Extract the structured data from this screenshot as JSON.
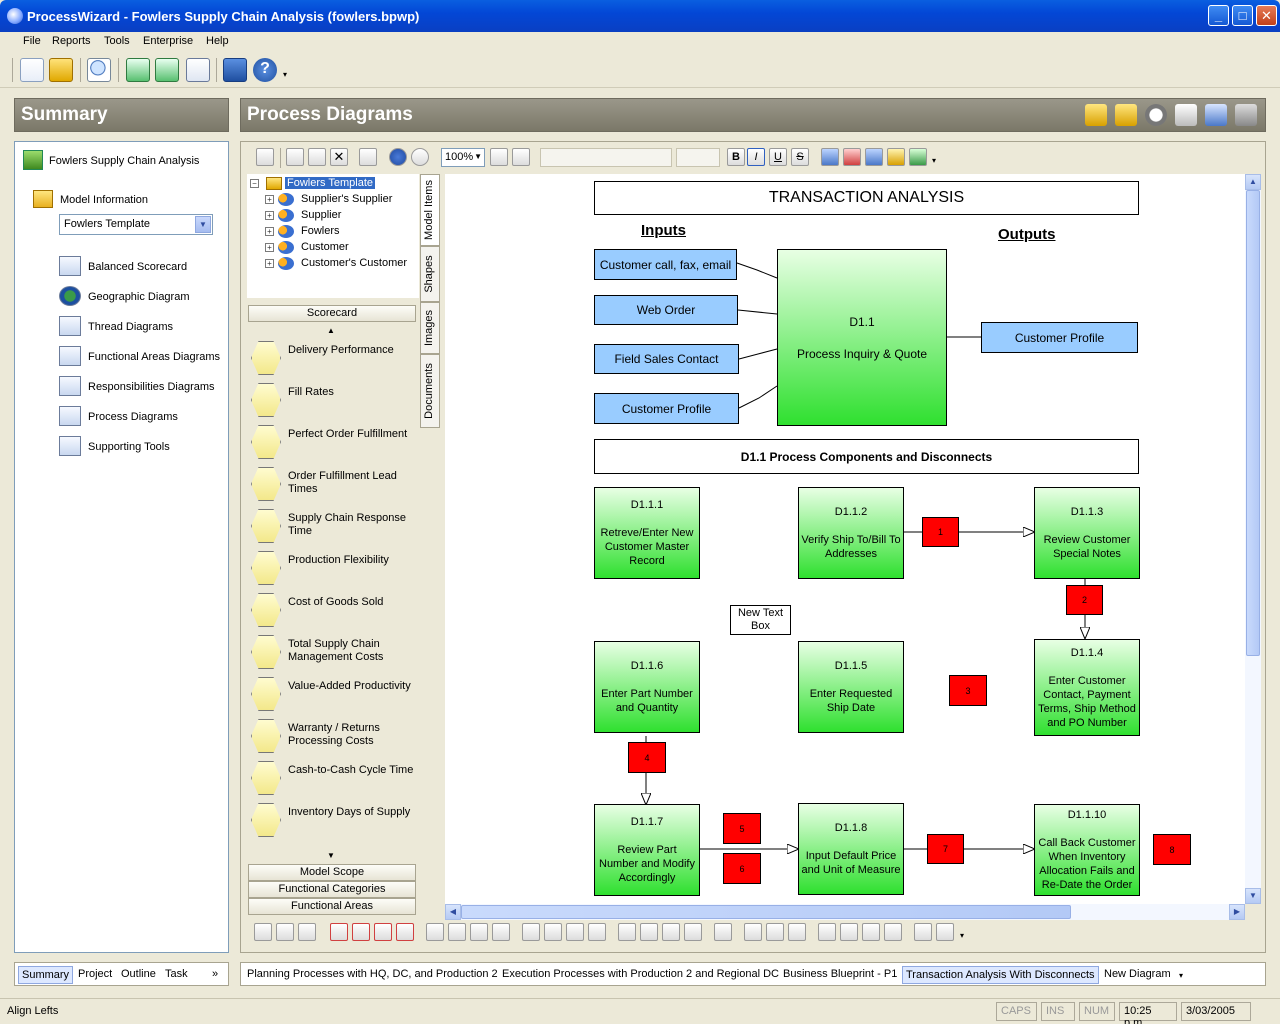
{
  "window": {
    "title": "ProcessWizard - Fowlers Supply Chain Analysis  (fowlers.bpwp)"
  },
  "menu": [
    "File",
    "Reports",
    "Tools",
    "Enterprise",
    "Help"
  ],
  "summary": {
    "heading": "Summary",
    "project": "Fowlers Supply Chain Analysis",
    "model_info_label": "Model Information",
    "model_select": "Fowlers Template",
    "items": [
      "Balanced Scorecard",
      "Geographic Diagram",
      "Thread Diagrams",
      "Functional Areas Diagrams",
      "Responsibilities Diagrams",
      "Process Diagrams",
      "Supporting Tools"
    ]
  },
  "process": {
    "heading": "Process Diagrams",
    "zoom": "100%",
    "tree": {
      "root": "Fowlers Template",
      "children": [
        "Supplier's Supplier",
        "Supplier",
        "Fowlers",
        "Customer",
        "Customer's Customer"
      ]
    },
    "side_tabs": [
      "Model Items",
      "Shapes",
      "Images",
      "Documents"
    ],
    "shapes": {
      "category": "Scorecard",
      "kpis": [
        "Delivery Performance",
        "Fill Rates",
        "Perfect Order Fulfillment",
        "Order Fulfillment Lead Times",
        "Supply Chain Response Time",
        "Production Flexibility",
        "Cost of Goods Sold",
        "Total Supply Chain Management Costs",
        "Value-Added Productivity",
        "Warranty / Returns Processing Costs",
        "Cash-to-Cash Cycle Time",
        "Inventory Days of Supply"
      ],
      "footer_bars": [
        "Model Scope",
        "Functional Categories",
        "Functional Areas"
      ]
    }
  },
  "diagram": {
    "title": "TRANSACTION ANALYSIS",
    "inputs_label": "Inputs",
    "outputs_label": "Outputs",
    "inputs": [
      "Customer call, fax, email",
      "Web Order",
      "Field Sales Contact",
      "Customer Profile"
    ],
    "main_process": {
      "id": "D1.1",
      "label": "Process Inquiry & Quote"
    },
    "output": "Customer Profile",
    "section_title": "D1.1 Process Components and Disconnects",
    "steps": [
      {
        "id": "D1.1.1",
        "label": "Retreve/Enter New Customer Master Record"
      },
      {
        "id": "D1.1.2",
        "label": "Verify Ship To/Bill To Addresses"
      },
      {
        "id": "D1.1.3",
        "label": "Review Customer Special Notes"
      },
      {
        "id": "D1.1.4",
        "label": "Enter Customer Contact, Payment Terms, Ship Method and PO Number"
      },
      {
        "id": "D1.1.5",
        "label": "Enter Requested Ship Date"
      },
      {
        "id": "D1.1.6",
        "label": "Enter Part Number and Quantity"
      },
      {
        "id": "D1.1.7",
        "label": "Review Part Number and Modify Accordingly"
      },
      {
        "id": "D1.1.8",
        "label": "Input Default Price and Unit of Measure"
      },
      {
        "id": "D1.1.10",
        "label": "Call Back Customer When Inventory Allocation Fails and Re-Date the Order"
      }
    ],
    "disconnects": [
      "1",
      "2",
      "3",
      "4",
      "5",
      "6",
      "7",
      "8"
    ],
    "text_box": "New Text Box"
  },
  "left_tabs": [
    "Summary",
    "Project",
    "Outline",
    "Task",
    "»"
  ],
  "diagram_tabs": [
    "Planning Processes with HQ, DC, and Production 2",
    "Execution Processes with Production 2 and Regional DC",
    "Business Blueprint - P1",
    "Transaction Analysis With Disconnects",
    "New Diagram"
  ],
  "status": {
    "message": "Align Lefts",
    "caps": "CAPS",
    "ins": "INS",
    "num": "NUM",
    "time": "10:25 p.m.",
    "date": "3/03/2005"
  },
  "colors": {
    "input_box": "#99ccff",
    "disconnect": "#ff0000",
    "process_gradient_end": "#2fe02f",
    "titlebar": "#0347d6"
  }
}
